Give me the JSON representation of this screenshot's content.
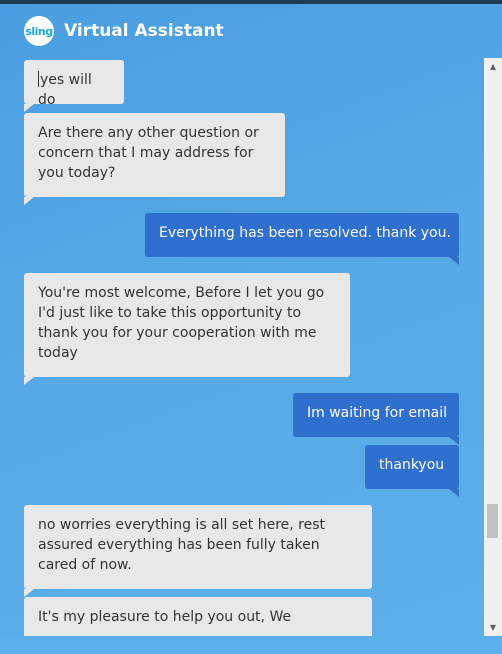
{
  "header": {
    "logo_text": "sling",
    "title": "Virtual Assistant"
  },
  "messages": [
    {
      "from": "bot",
      "text": "yes will do"
    },
    {
      "from": "bot",
      "text": "Are there any other question or concern that I may address for you today?"
    },
    {
      "from": "user",
      "text": "Everything has been resolved. thank you."
    },
    {
      "from": "bot",
      "text": "You're most welcome, Before I let you go I'd just like to take this opportunity to thank you for your cooperation with me today"
    },
    {
      "from": "user",
      "text": "Im waiting for email"
    },
    {
      "from": "user",
      "text": "thankyou"
    },
    {
      "from": "bot",
      "text": "no worries everything is all set here, rest assured everything has been fully taken cared of now."
    },
    {
      "from": "bot",
      "text": "It's my pleasure to help you out, We"
    }
  ],
  "colors": {
    "background": "#56a9e6",
    "bot_bubble": "#e8e8e8",
    "user_bubble": "#2f6fce"
  },
  "icons": {
    "scroll_up": "scroll-up-arrow-icon",
    "scroll_down": "scroll-down-arrow-icon"
  }
}
